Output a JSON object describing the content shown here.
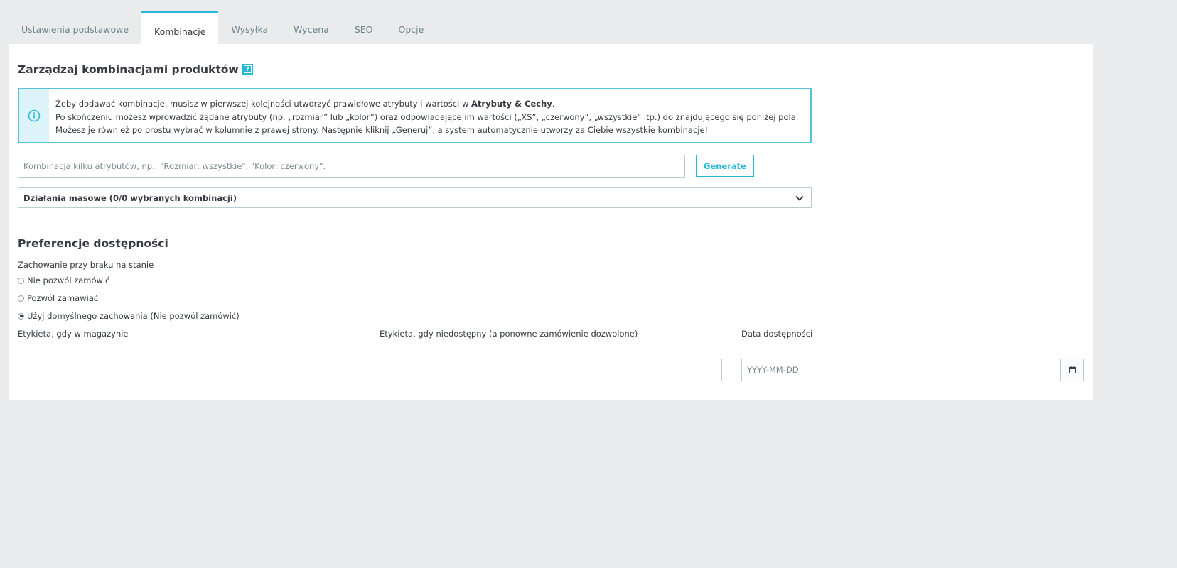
{
  "tabs": [
    {
      "label": "Ustawienia podstawowe"
    },
    {
      "label": "Kombinacje"
    },
    {
      "label": "Wysyłka"
    },
    {
      "label": "Wycena"
    },
    {
      "label": "SEO"
    },
    {
      "label": "Opcje"
    }
  ],
  "combinations": {
    "title": "Zarządzaj kombinacjami produktów",
    "help_icon": "question-icon",
    "info": {
      "icon": "info-circle-icon",
      "line1_pre": "Żeby dodawać kombinacje, musisz w pierwszej kolejności utworzyć prawidłowe atrybuty i wartości w ",
      "line1_bold": "Atrybuty & Cechy",
      "line1_post": ".",
      "line2": "Po skończeniu możesz wprowadzić żądane atrybuty (np. „rozmiar” lub „kolor”) oraz odpowiadające im wartości („XS”, „czerwony”, „wszystkie” itp.) do znajdującego się poniżej pola.",
      "line3": "Możesz je również po prostu wybrać w kolumnie z prawej strony. Następnie kliknij „Generuj”, a system automatycznie utworzy za Ciebie wszystkie kombinacje!"
    },
    "input_placeholder": "Kombinacja kilku atrybutów, np.: \"Rozmiar: wszystkie\", \"Kolor: czerwony\".",
    "generate_label": "Generate",
    "bulk_label": "Działania masowe (0/0 wybranych kombinacji)",
    "bulk_icon": "chevron-down-icon"
  },
  "availability": {
    "title": "Preferencje dostępności",
    "oos_label": "Zachowanie przy braku na stanie",
    "options": [
      {
        "label": "Nie pozwól zamówić",
        "checked": false
      },
      {
        "label": "Pozwól zamawiać",
        "checked": false
      },
      {
        "label": "Użyj domyślnego zachowania (Nie pozwól zamówić)",
        "checked": true
      }
    ],
    "label_in_stock": "Etykieta, gdy w magazynie",
    "label_in_stock_value": "",
    "label_oos": "Etykieta, gdy niedostępny (a ponowne zamówienie dozwolone)",
    "label_oos_value": "",
    "date_label": "Data dostępności",
    "date_placeholder": "YYYY-MM-DD",
    "date_icon": "calendar-icon"
  },
  "colors": {
    "accent": "#25b9d7",
    "background": "#eaebec",
    "text": "#363a41"
  }
}
